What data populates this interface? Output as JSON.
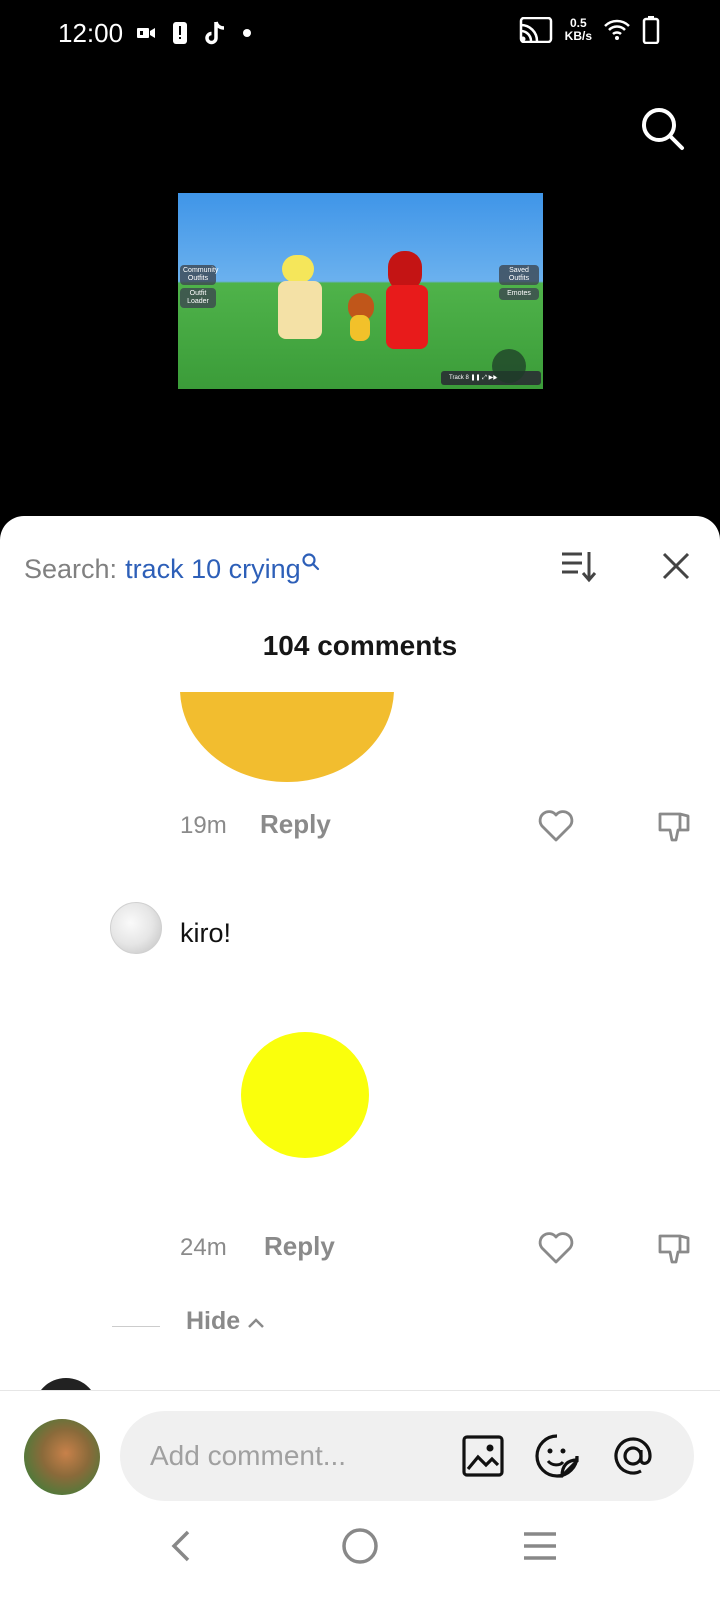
{
  "status_bar": {
    "time": "12:00",
    "speed_value": "0.5",
    "speed_unit": "KB/s",
    "left_icons": [
      "video-record-icon",
      "alert-icon",
      "tiktok-icon",
      "dot-icon"
    ],
    "right_icons": [
      "cast-icon",
      "wifi-icon",
      "battery-icon"
    ]
  },
  "video": {
    "left_buttons": [
      "Community Outfits",
      "Outfit Loader"
    ],
    "right_buttons": [
      "Saved Outfits",
      "Emotes"
    ],
    "player_label": "Track 8"
  },
  "sheet": {
    "search_label": "Search:",
    "search_query": "track 10 crying",
    "comments_count": "104 comments"
  },
  "comments": [
    {
      "time": "19m",
      "reply_label": "Reply"
    },
    {
      "text": "kiro!",
      "time": "24m",
      "reply_label": "Reply"
    }
  ],
  "hide_label": "Hide",
  "composer": {
    "placeholder": "Add comment..."
  },
  "colors": {
    "accent_link": "#2d5fb8",
    "sticker_orange": "#f2bd2f",
    "sticker_yellow": "#faff0c"
  }
}
